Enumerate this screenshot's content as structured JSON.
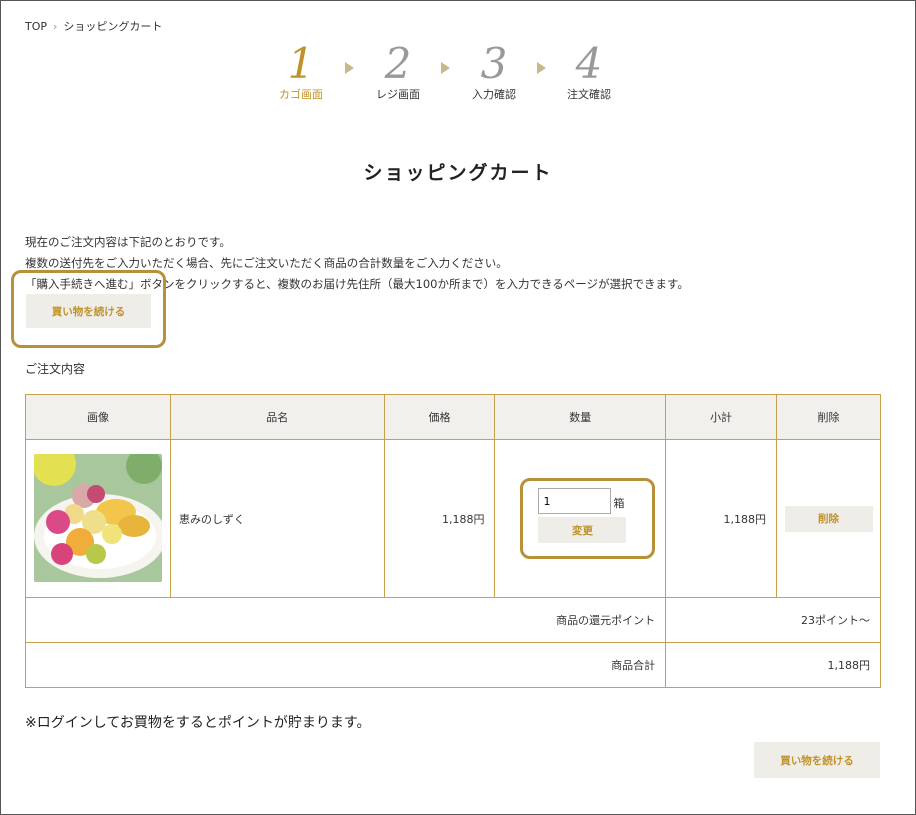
{
  "breadcrumb": {
    "home": "TOP",
    "separator": "›",
    "current": "ショッピングカート"
  },
  "steps": [
    {
      "num": "1",
      "label": "カゴ画面",
      "active": true
    },
    {
      "num": "2",
      "label": "レジ画面",
      "active": false
    },
    {
      "num": "3",
      "label": "入力確認",
      "active": false
    },
    {
      "num": "4",
      "label": "注文確認",
      "active": false
    }
  ],
  "page_title": "ショッピングカート",
  "intro": {
    "line1": "現在のご注文内容は下記のとおりです。",
    "line2": "複数の送付先をご入力いただく場合、先にご注文いただく商品の合計数量をご入力ください。",
    "line3": "「購入手続きへ進む」ボタンをクリックすると、複数のお届け先住所（最大100か所まで）を入力できるページが選択できます。"
  },
  "continue_shopping_label": "買い物を続ける",
  "order_section_label": "ご注文内容",
  "table": {
    "headers": {
      "image": "画像",
      "name": "品名",
      "price": "価格",
      "quantity": "数量",
      "subtotal": "小計",
      "delete": "削除"
    },
    "items": [
      {
        "name": "恵みのしずく",
        "price": "1,188円",
        "quantity": "1",
        "unit": "箱",
        "change_label": "変更",
        "subtotal": "1,188円",
        "delete_label": "削除"
      }
    ],
    "points_label": "商品の還元ポイント",
    "points_value": "23ポイント〜",
    "total_label": "商品合計",
    "total_value": "1,188円"
  },
  "notice": "※ログインしてお買物をするとポイントが貯まります。",
  "colors": {
    "accent": "#c0922a",
    "border": "#c8a04a",
    "button_bg": "#efede8",
    "header_bg": "#f2f0ed",
    "highlight": "#b8903a"
  }
}
